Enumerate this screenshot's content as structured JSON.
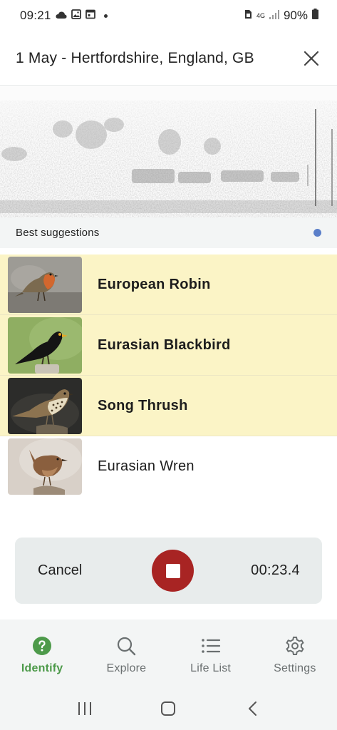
{
  "status_bar": {
    "time": "09:21",
    "network": "4G",
    "battery": "90%",
    "left_icons": [
      "cloud-icon",
      "image-icon",
      "calendar-icon",
      "notification-dot-icon"
    ],
    "right_icons": [
      "sim-icon",
      "signal-icon",
      "battery-icon"
    ]
  },
  "header": {
    "title": "1 May - Hertfordshire, England, GB",
    "close_icon": "close-icon"
  },
  "suggestions": {
    "label": "Best suggestions",
    "status_dot_color": "#5b7fc9",
    "items": [
      {
        "name": "European Robin",
        "highlighted": true
      },
      {
        "name": "Eurasian Blackbird",
        "highlighted": true
      },
      {
        "name": "Song Thrush",
        "highlighted": true
      },
      {
        "name": "Eurasian Wren",
        "highlighted": false
      }
    ]
  },
  "recording": {
    "cancel_label": "Cancel",
    "timer": "00:23.4",
    "stop_color": "#a82423"
  },
  "bottom_nav": {
    "items": [
      {
        "label": "Identify",
        "icon": "question-circle-icon",
        "active": true
      },
      {
        "label": "Explore",
        "icon": "search-icon",
        "active": false
      },
      {
        "label": "Life List",
        "icon": "list-icon",
        "active": false
      },
      {
        "label": "Settings",
        "icon": "gear-icon",
        "active": false
      }
    ]
  },
  "colors": {
    "highlight_row": "#fbf4c6",
    "active_nav": "#4d9a4a",
    "inactive_nav": "#6a6f70"
  }
}
